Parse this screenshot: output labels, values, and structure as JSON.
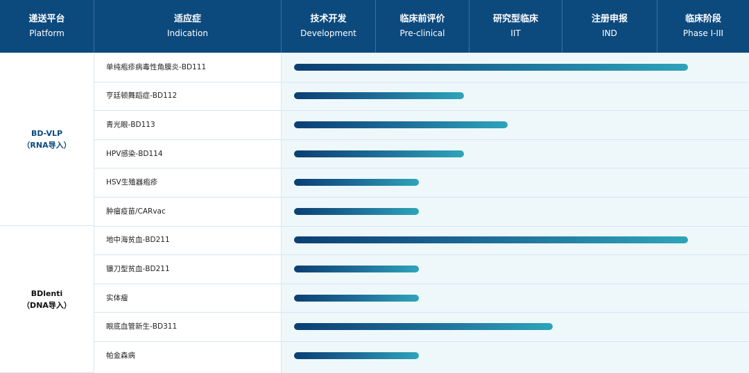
{
  "header": {
    "platform": {
      "zh": "递送平台",
      "en": "Platform"
    },
    "indication": {
      "zh": "适应症",
      "en": "Indication"
    },
    "stages": [
      {
        "zh": "技术开发",
        "en": "Development"
      },
      {
        "zh": "临床前评价",
        "en": "Pre-clinical"
      },
      {
        "zh": "研究型临床",
        "en": "IIT"
      },
      {
        "zh": "注册申报",
        "en": "IND"
      },
      {
        "zh": "临床阶段",
        "en": "Phase I-III"
      }
    ]
  },
  "platforms": [
    {
      "name": "BD-VLP",
      "sub": "（RNA导入）",
      "color": "#0c4a7e"
    },
    {
      "name": "BDlenti",
      "sub": "（DNA导入）",
      "color": "#111111"
    }
  ],
  "chart_data": {
    "type": "bar",
    "orientation": "horizontal",
    "value_unit": "stage progress (0 = start of Development, 5 = end of Phase I-III)",
    "xlim": [
      0,
      5
    ],
    "categories": [
      "单纯疱疹病毒性角膜炎-BD111",
      "亨廷顿舞蹈症-BD112",
      "青光眼-BD113",
      "HPV感染-BD114",
      "HSV生殖器疱疹",
      "肿瘤疫苗/CARvac",
      "地中海贫血-BD211",
      "镰刀型贫血-BD211",
      "实体瘤",
      "眼底血管新生-BD311",
      "帕金森病"
    ],
    "platform_of_row": [
      0,
      0,
      0,
      0,
      0,
      0,
      1,
      1,
      1,
      1,
      1
    ],
    "values": [
      4.35,
      1.95,
      2.42,
      1.95,
      1.47,
      1.47,
      4.35,
      1.47,
      1.47,
      2.9,
      1.47
    ],
    "colors": {
      "bar_start": "#0b3f73",
      "bar_end": "#2ea4b9",
      "header_bg": "#0c4a7e"
    }
  }
}
